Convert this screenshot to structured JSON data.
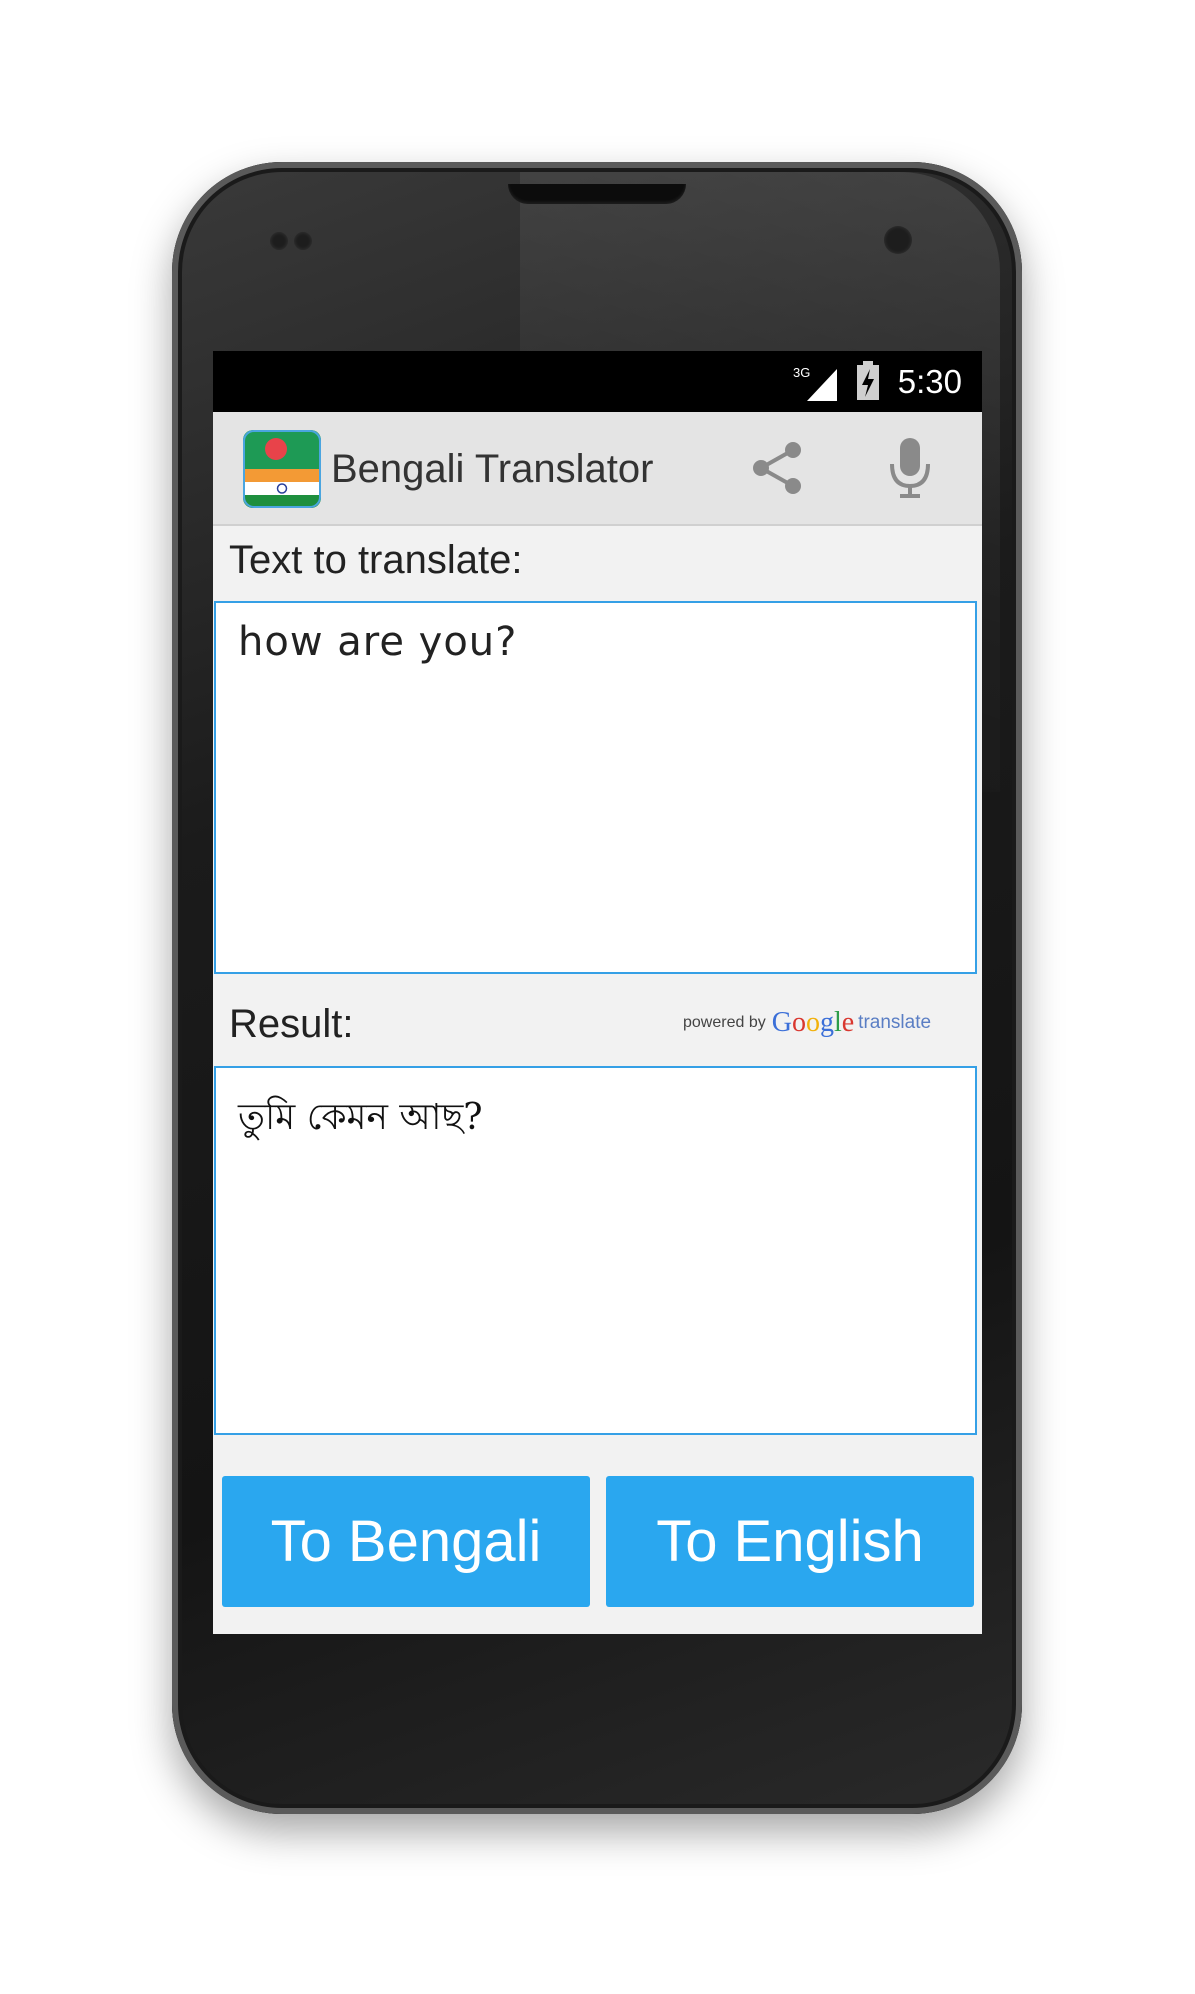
{
  "status_bar": {
    "network": "3G",
    "time": "5:30"
  },
  "action_bar": {
    "title": "Bengali Translator",
    "icons": {
      "app": "bangladesh-india-flag-icon",
      "share": "share-icon",
      "mic": "microphone-icon"
    }
  },
  "input": {
    "label": "Text to translate:",
    "value": "how are you?"
  },
  "result": {
    "label": "Result:",
    "value": "তুমি কেমন আছ?",
    "powered_by": "powered by",
    "google": [
      "G",
      "o",
      "o",
      "g",
      "l",
      "e"
    ],
    "translate": "translate"
  },
  "buttons": {
    "to_bengali": "To Bengali",
    "to_english": "To English"
  },
  "colors": {
    "accent": "#2aa7ef",
    "border": "#35a0e6",
    "action_bar": "#e4e4e4",
    "screen_bg": "#f2f2f2",
    "google_letters": [
      "#3b6fd8",
      "#d9372f",
      "#f2b10c",
      "#3b6fd8",
      "#2e9d4a",
      "#d9372f"
    ]
  }
}
